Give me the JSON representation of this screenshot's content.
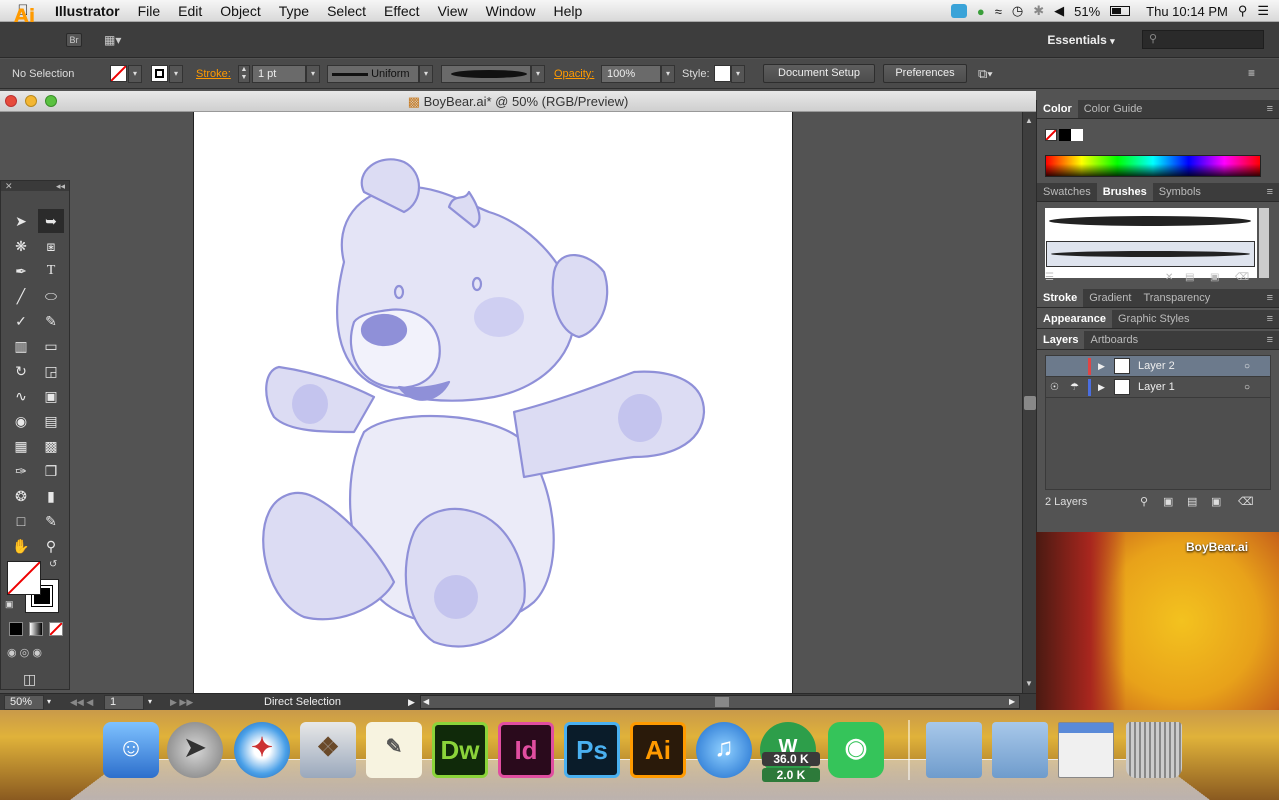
{
  "menubar": {
    "app_name": "Illustrator",
    "items": [
      "File",
      "Edit",
      "Object",
      "Type",
      "Select",
      "Effect",
      "View",
      "Window",
      "Help"
    ],
    "battery": "51%",
    "clock": "Thu 10:14 PM"
  },
  "appbar": {
    "logo": "Ai",
    "bridge": "Br",
    "workspace": "Essentials",
    "search_placeholder": ""
  },
  "control": {
    "selection": "No Selection",
    "stroke_label": "Stroke:",
    "stroke_weight": "1 pt",
    "profile": "Uniform",
    "opacity_label": "Opacity:",
    "opacity": "100%",
    "style_label": "Style:",
    "document_setup": "Document Setup",
    "preferences": "Preferences"
  },
  "document": {
    "title": "BoyBear.ai* @ 50% (RGB/Preview)"
  },
  "status": {
    "zoom": "50%",
    "artboard": "1",
    "tool": "Direct Selection"
  },
  "panels": {
    "color_tabs": [
      "Color",
      "Color Guide"
    ],
    "brush_tabs": [
      "Swatches",
      "Brushes",
      "Symbols"
    ],
    "stroke_tabs": [
      "Stroke",
      "Gradient",
      "Transparency"
    ],
    "appearance_tabs": [
      "Appearance",
      "Graphic Styles"
    ],
    "layers_tabs": [
      "Layers",
      "Artboards"
    ],
    "layers": [
      {
        "name": "Layer 2",
        "color": "#e04545"
      },
      {
        "name": "Layer 1",
        "color": "#4a6ee0"
      }
    ],
    "layer_count": "2 Layers"
  },
  "desktop": {
    "file_label": "BoyBear.ai"
  },
  "dock": {
    "apps": [
      "Dw",
      "Id",
      "Ps",
      "Ai"
    ],
    "net_up": "36.0 K",
    "net_down": "2.0 K"
  }
}
